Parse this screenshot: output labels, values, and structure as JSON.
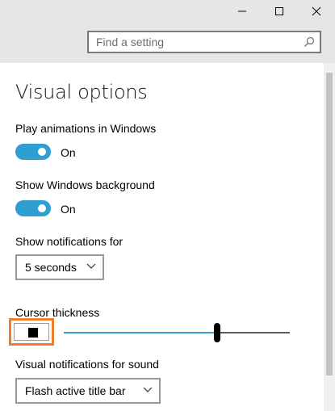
{
  "window_controls": {
    "minimize_icon": "minimize-icon",
    "maximize_icon": "maximize-icon",
    "close_icon": "close-icon"
  },
  "search": {
    "placeholder": "Find a setting",
    "icon": "search-icon"
  },
  "page": {
    "title": "Visual options"
  },
  "settings": {
    "play_animations": {
      "label": "Play animations in Windows",
      "state": "On"
    },
    "show_background": {
      "label": "Show Windows background",
      "state": "On"
    },
    "notifications": {
      "label": "Show notifications for",
      "selected": "5 seconds"
    },
    "cursor_thickness": {
      "label": "Cursor thickness",
      "slider_fraction": 0.68
    },
    "visual_notifications": {
      "label": "Visual notifications for sound",
      "selected": "Flash active title bar"
    }
  },
  "colors": {
    "accent": "#2f9ed1",
    "focus_outline": "#ee7f2d",
    "title_bar": "#e6e6e6"
  }
}
